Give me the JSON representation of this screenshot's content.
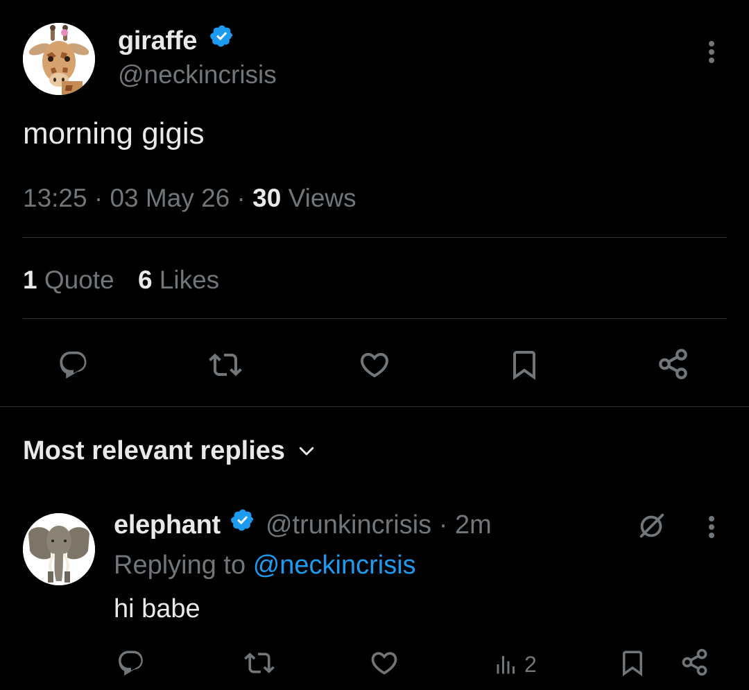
{
  "tweet": {
    "display_name": "giraffe",
    "handle": "@neckincrisis",
    "text": "morning gigis",
    "time": "13:25",
    "date": "03 May 26",
    "separator": "·",
    "views_count": "30",
    "views_label": "Views",
    "quotes_count": "1",
    "quotes_label": "Quote",
    "likes_count": "6",
    "likes_label": "Likes"
  },
  "replies_section": {
    "title": "Most relevant replies"
  },
  "reply": {
    "display_name": "elephant",
    "handle": "@trunkincrisis",
    "separator": "·",
    "age": "2m",
    "replying_to_label": "Replying to",
    "replying_to_handle": "@neckincrisis",
    "text": "hi babe",
    "views_count": "2"
  },
  "colors": {
    "background": "#000000",
    "primary_text": "#e7e9ea",
    "secondary_text": "#71767b",
    "accent": "#1d9bf0",
    "divider": "#2f3336"
  },
  "icons": {
    "verified": "verified-badge-icon",
    "more": "more-vertical-icon",
    "reply": "reply-icon",
    "repost": "repost-icon",
    "like": "heart-icon",
    "bookmark": "bookmark-icon",
    "share": "share-icon",
    "chevron": "chevron-down-icon",
    "grok": "grok-icon",
    "views": "views-chart-icon"
  }
}
